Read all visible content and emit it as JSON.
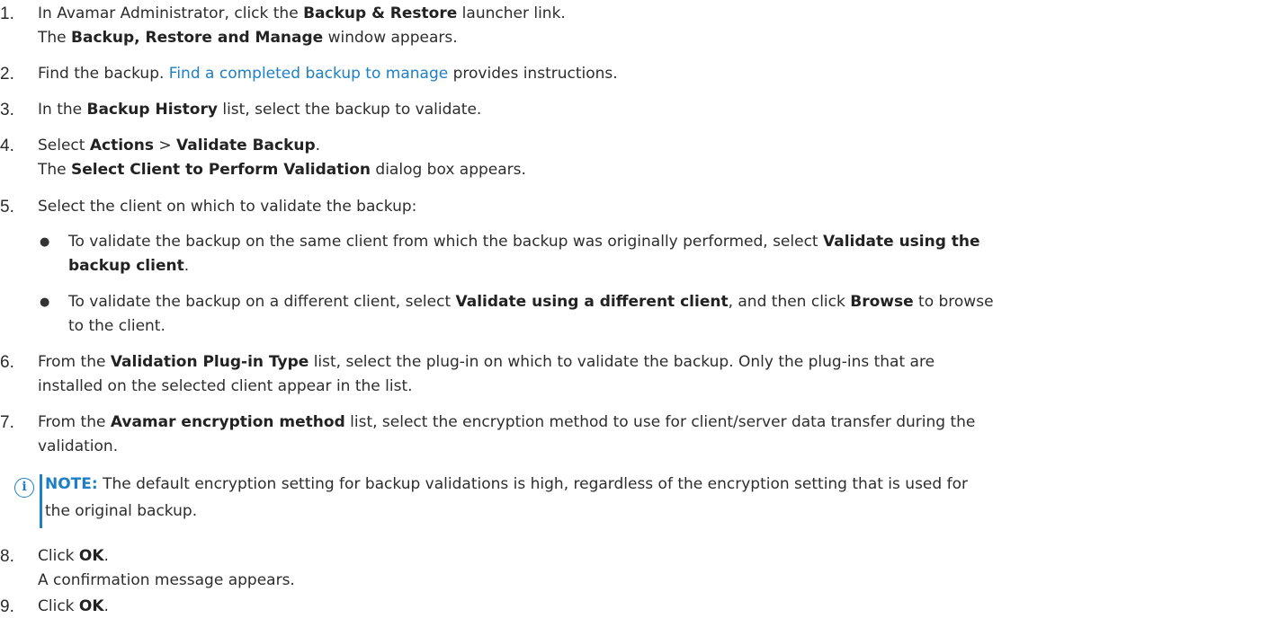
{
  "steps": [
    {
      "num": "1.",
      "pre": "In Avamar Administrator, click the ",
      "b1": "Backup & Restore",
      "post": " launcher link.",
      "sub_b": "Backup, Restore and Manage",
      "sub_post": " window appears.",
      "sub_pre": "The "
    },
    {
      "num": "2.",
      "pre": "Find the backup. ",
      "link": "Find a completed backup to manage",
      "post": " provides instructions."
    },
    {
      "num": "3.",
      "pre": "In the ",
      "b1": "Backup History",
      "post": " list, select the backup to validate."
    },
    {
      "num": "4.",
      "pre": "Select ",
      "b1": "Actions",
      "mid": " > ",
      "b2": "Validate Backup",
      "post": ".",
      "sub_pre": "The ",
      "sub_b": "Select Client to Perform Validation",
      "sub_post": " dialog box appears."
    },
    {
      "num": "5.",
      "text": "Select the client on which to validate the backup:",
      "bullets": [
        {
          "dot": "●",
          "l1_pre": "To validate the backup on the same client from which the backup was originally performed, select ",
          "l1_b": "Validate using the",
          "l2_b": "backup client",
          "l2_post": "."
        },
        {
          "dot": "●",
          "l1_pre": "To validate the backup on a different client, select ",
          "l1_b": "Validate using a different client",
          "l1_mid": ", and then click ",
          "l1_b2": "Browse",
          "l1_post": " to browse",
          "l2_post": "to the client."
        }
      ]
    },
    {
      "num": "6.",
      "pre": "From the ",
      "b1": "Validation Plug-in Type",
      "post": " list, select the plug-in on which to validate the backup. Only the plug-ins that are",
      "line2": "installed on the selected client appear in the list."
    },
    {
      "num": "7.",
      "pre": "From the ",
      "b1": "Avamar encryption method",
      "post": " list, select the encryption method to use for client/server data transfer during the",
      "line2": "validation."
    },
    {
      "num": "8.",
      "pre": "Click ",
      "b1": "OK",
      "post": ".",
      "sub_text": "A confirmation message appears."
    },
    {
      "num": "9.",
      "pre": "Click ",
      "b1": "OK",
      "post": "."
    }
  ],
  "note": {
    "icon": "i",
    "icon_name": "info-icon",
    "label": "NOTE:",
    "line1": " The default encryption setting for backup validations is high, regardless of the encryption setting that is used for",
    "line2": "the original backup."
  },
  "colors": {
    "link": "#1d7fc4",
    "text": "#2d2d2d"
  }
}
